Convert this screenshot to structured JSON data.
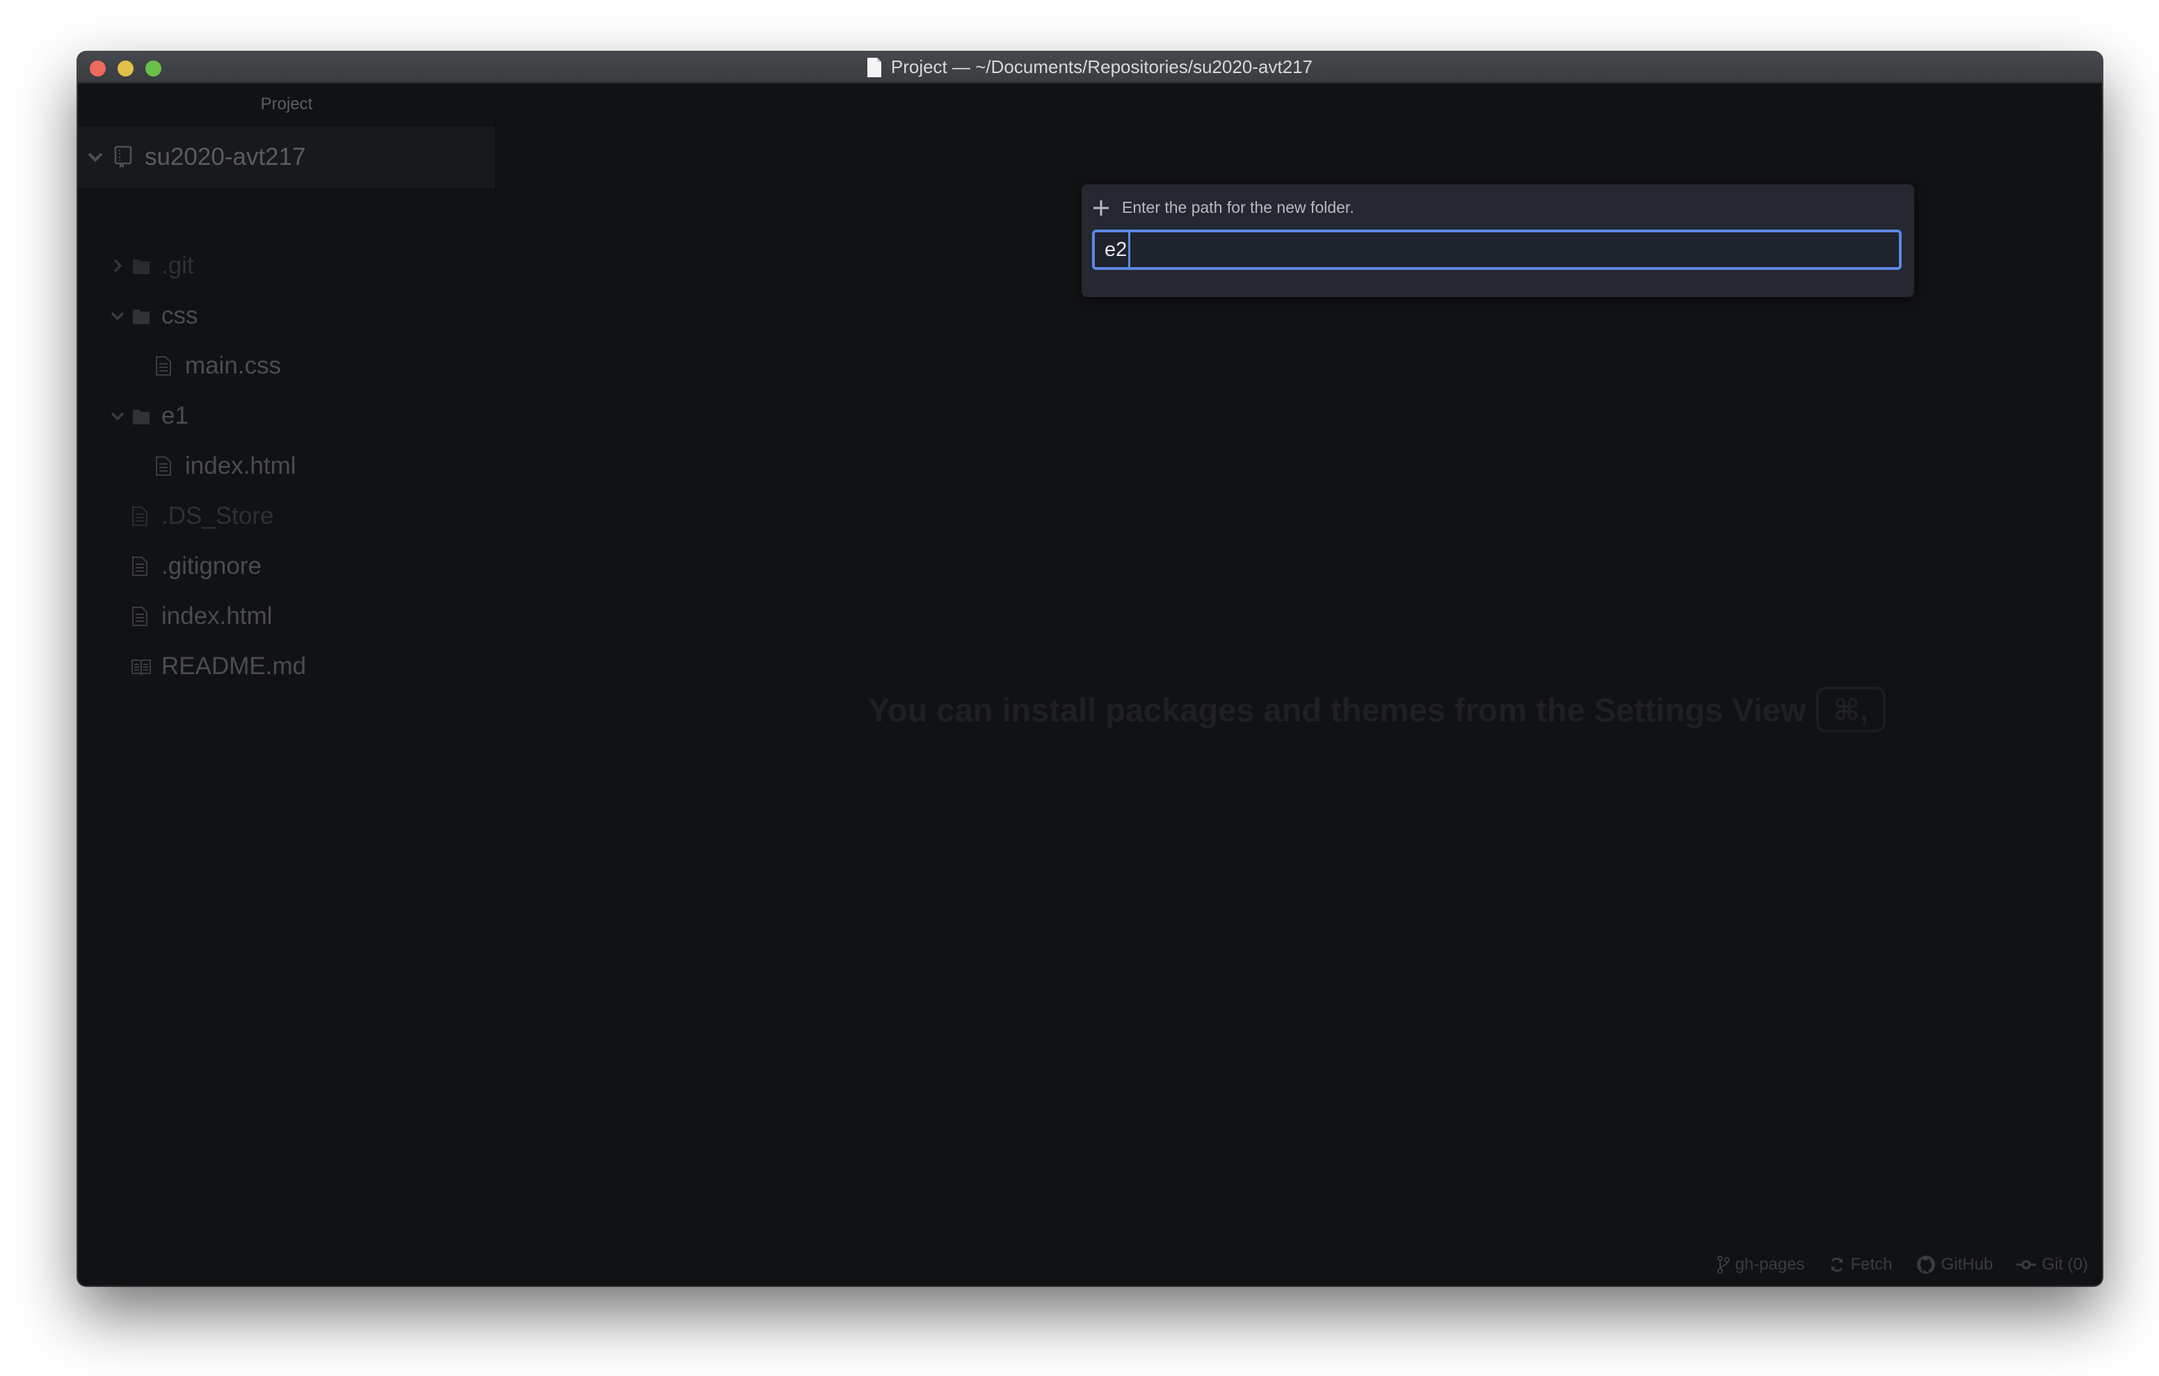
{
  "window": {
    "title": "Project — ~/Documents/Repositories/su2020-avt217",
    "traffic_lights": {
      "close_color": "#ee6a5f",
      "minimize_color": "#e2c04a",
      "maximize_color": "#6ac04a"
    }
  },
  "sidebar": {
    "header": "Project",
    "root": {
      "label": "su2020-avt217",
      "icon": "repo-icon",
      "expanded": true
    },
    "items": [
      {
        "label": ".git",
        "type": "folder",
        "expanded": false,
        "depth": 1,
        "ignored": true
      },
      {
        "label": "css",
        "type": "folder",
        "expanded": true,
        "depth": 1,
        "ignored": false
      },
      {
        "label": "main.css",
        "type": "file",
        "depth": 2,
        "ignored": false
      },
      {
        "label": "e1",
        "type": "folder",
        "expanded": true,
        "depth": 1,
        "ignored": false
      },
      {
        "label": "index.html",
        "type": "file",
        "depth": 2,
        "ignored": false
      },
      {
        "label": ".DS_Store",
        "type": "file",
        "depth": 1,
        "ignored": true
      },
      {
        "label": ".gitignore",
        "type": "file",
        "depth": 1,
        "ignored": false
      },
      {
        "label": "index.html",
        "type": "file",
        "depth": 1,
        "ignored": false
      },
      {
        "label": "README.md",
        "type": "book-file",
        "depth": 1,
        "ignored": false
      }
    ]
  },
  "dialog": {
    "icon": "plus-icon",
    "prompt": "Enter the path for the new folder.",
    "input_value": "e2",
    "accent_color": "#5b88e6"
  },
  "editor": {
    "hint": "You can install packages and themes from the Settings View",
    "hint_shortcut": "⌘,"
  },
  "statusbar": {
    "branch": "gh-pages",
    "fetch": "Fetch",
    "github": "GitHub",
    "git": "Git (0)"
  }
}
